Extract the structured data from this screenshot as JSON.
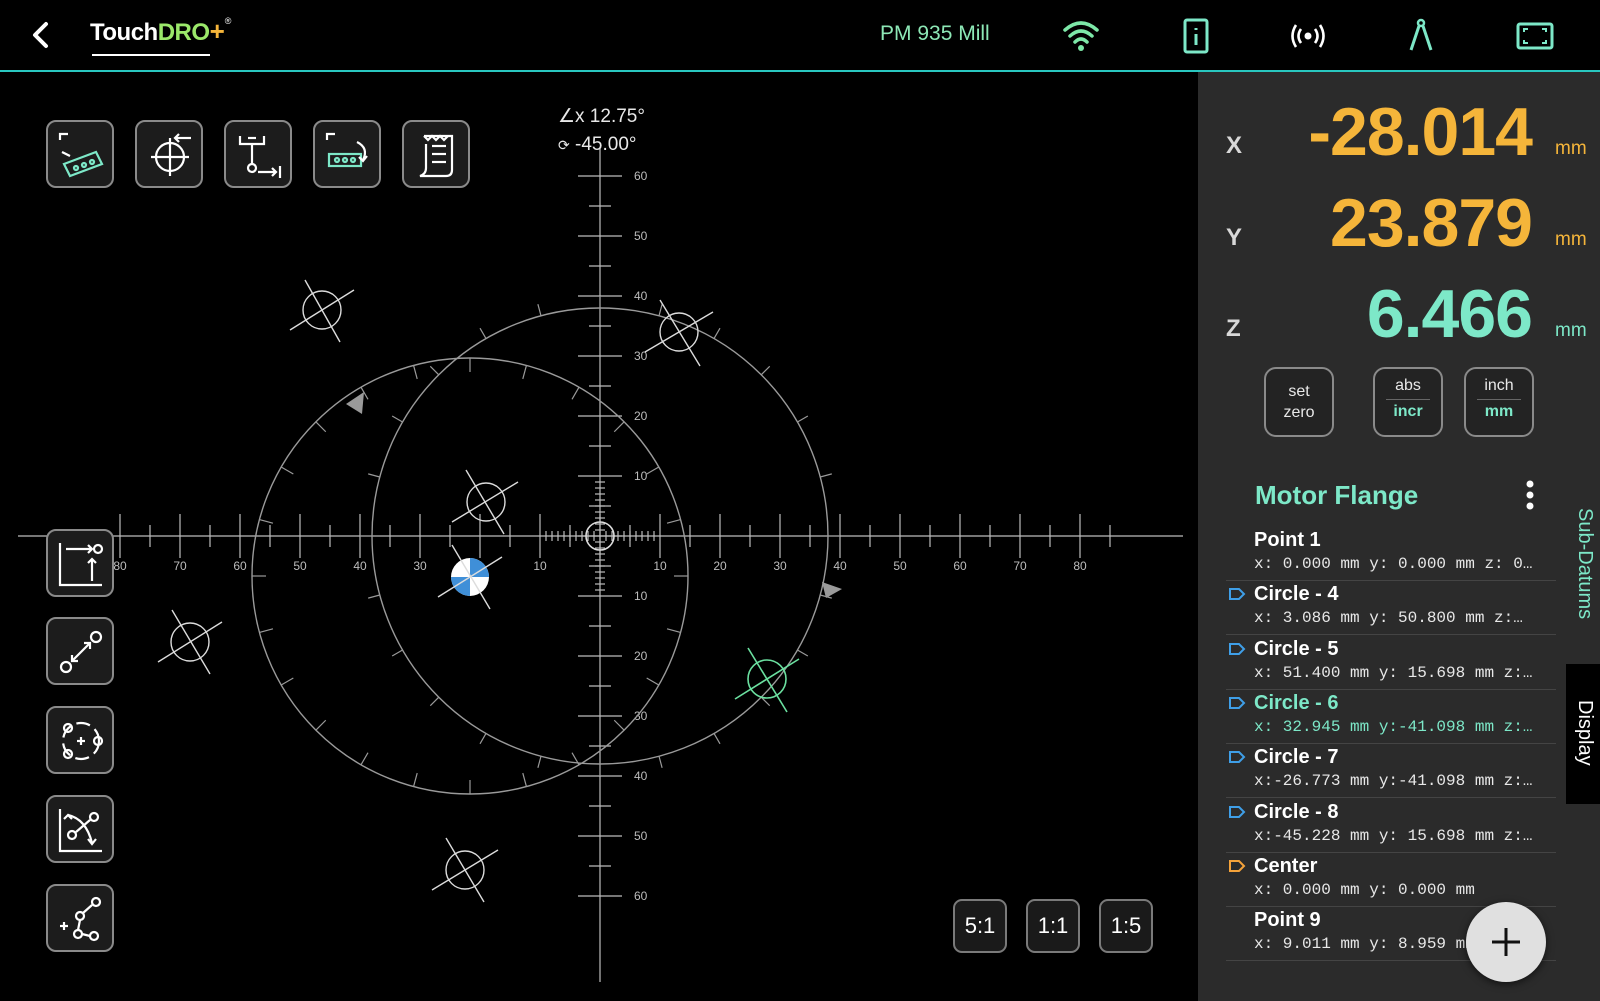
{
  "header": {
    "logo_text_a": "Touch",
    "logo_text_b": "DRO",
    "logo_plus": "+",
    "logo_reg": "®",
    "machine_name": "PM 935 Mill",
    "icons": [
      "back-arrow-icon",
      "wifi-icon",
      "device-info-icon",
      "broadcast-icon",
      "compass-icon",
      "fullscreen-icon"
    ]
  },
  "toolbar_top": [
    "bolt-circle-pattern-icon",
    "center-find-icon",
    "edge-find-icon",
    "hole-pattern-icon",
    "notes-icon"
  ],
  "toolbar_left": [
    "move-datum-icon",
    "distance-tool-icon",
    "circle-center-icon",
    "transform-icon",
    "point-path-icon"
  ],
  "readout": {
    "angle": "∠x 12.75°",
    "rotation": "-45.00°"
  },
  "axis_ticks": {
    "horizontal": [
      "80",
      "70",
      "60",
      "50",
      "40",
      "30",
      "10",
      "10",
      "20",
      "30",
      "40",
      "50",
      "60",
      "70",
      "80"
    ],
    "vertical_up": [
      "60",
      "50",
      "40",
      "30",
      "20",
      "10"
    ],
    "vertical_down": [
      "10",
      "20",
      "30",
      "40",
      "50",
      "60"
    ]
  },
  "scale_buttons": [
    "5:1",
    "1:1",
    "1:5"
  ],
  "dro": {
    "x": {
      "label": "X",
      "value": "-28.014",
      "unit": "mm",
      "color": "#f5b53a"
    },
    "y": {
      "label": "Y",
      "value": "23.879",
      "unit": "mm",
      "color": "#f5b53a"
    },
    "z": {
      "label": "Z",
      "value": "6.466",
      "unit": "mm",
      "color": "#7de8c8"
    },
    "buttons": {
      "set_zero": [
        "set",
        "zero"
      ],
      "abs_incr": [
        "abs",
        "incr"
      ],
      "inch_mm": [
        "inch",
        "mm"
      ]
    }
  },
  "list": {
    "title": "Motor Flange",
    "items": [
      {
        "name": "Point 1",
        "coords": "x: 0.000 mm y: 0.000 mm z: 0…",
        "tag": "none"
      },
      {
        "name": "Circle - 4",
        "coords": "x: 3.086 mm y: 50.800 mm z:…",
        "tag": "blue"
      },
      {
        "name": "Circle - 5",
        "coords": "x: 51.400 mm y: 15.698 mm z:…",
        "tag": "blue"
      },
      {
        "name": "Circle - 6",
        "coords": "x: 32.945 mm y:-41.098 mm z:…",
        "tag": "blue",
        "active": true
      },
      {
        "name": "Circle - 7",
        "coords": "x:-26.773 mm y:-41.098 mm z:…",
        "tag": "blue"
      },
      {
        "name": "Circle - 8",
        "coords": "x:-45.228 mm y: 15.698 mm z:…",
        "tag": "blue"
      },
      {
        "name": "Center",
        "coords": "x: 0.000 mm y: 0.000 mm",
        "tag": "orange"
      },
      {
        "name": "Point 9",
        "coords": "x: 9.011 mm y: 8.959 mm z: 1…",
        "tag": "none"
      }
    ]
  },
  "side_tabs": {
    "sub_datums": "Sub-Datums",
    "display": "Display"
  },
  "fab_icon": "plus-icon"
}
